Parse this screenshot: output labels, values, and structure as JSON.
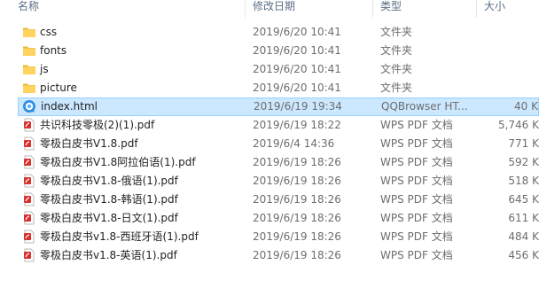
{
  "columns": {
    "name": "名称",
    "date": "修改日期",
    "type": "类型",
    "size": "大小"
  },
  "files": [
    {
      "name": "css",
      "date": "2019/6/20 10:41",
      "type": "文件夹",
      "size": "",
      "icon": "folder-icon"
    },
    {
      "name": "fonts",
      "date": "2019/6/20 10:41",
      "type": "文件夹",
      "size": "",
      "icon": "folder-icon"
    },
    {
      "name": "js",
      "date": "2019/6/20 10:41",
      "type": "文件夹",
      "size": "",
      "icon": "folder-icon"
    },
    {
      "name": "picture",
      "date": "2019/6/20 10:41",
      "type": "文件夹",
      "size": "",
      "icon": "folder-icon"
    },
    {
      "name": "index.html",
      "date": "2019/6/19 19:34",
      "type": "QQBrowser HT...",
      "size": "40 K",
      "icon": "qqbrowser-html-icon",
      "selected": true
    },
    {
      "name": "共识科技零极(2)(1).pdf",
      "date": "2019/6/19 18:22",
      "type": "WPS PDF 文档",
      "size": "5,746 K",
      "icon": "pdf-icon"
    },
    {
      "name": "零极白皮书V1.8.pdf",
      "date": "2019/6/4 14:36",
      "type": "WPS PDF 文档",
      "size": "771 K",
      "icon": "pdf-icon"
    },
    {
      "name": "零极白皮书V1.8阿拉伯语(1).pdf",
      "date": "2019/6/19 18:26",
      "type": "WPS PDF 文档",
      "size": "592 K",
      "icon": "pdf-icon"
    },
    {
      "name": "零极白皮书V1.8-俄语(1).pdf",
      "date": "2019/6/19 18:26",
      "type": "WPS PDF 文档",
      "size": "518 K",
      "icon": "pdf-icon"
    },
    {
      "name": "零极白皮书V1.8-韩语(1).pdf",
      "date": "2019/6/19 18:26",
      "type": "WPS PDF 文档",
      "size": "645 K",
      "icon": "pdf-icon"
    },
    {
      "name": "零极白皮书V1.8-日文(1).pdf",
      "date": "2019/6/19 18:26",
      "type": "WPS PDF 文档",
      "size": "611 K",
      "icon": "pdf-icon"
    },
    {
      "name": "零极白皮书v1.8-西班牙语(1).pdf",
      "date": "2019/6/19 18:26",
      "type": "WPS PDF 文档",
      "size": "484 K",
      "icon": "pdf-icon"
    },
    {
      "name": "零极白皮书v1.8-英语(1).pdf",
      "date": "2019/6/19 18:26",
      "type": "WPS PDF 文档",
      "size": "456 K",
      "icon": "pdf-icon"
    }
  ]
}
